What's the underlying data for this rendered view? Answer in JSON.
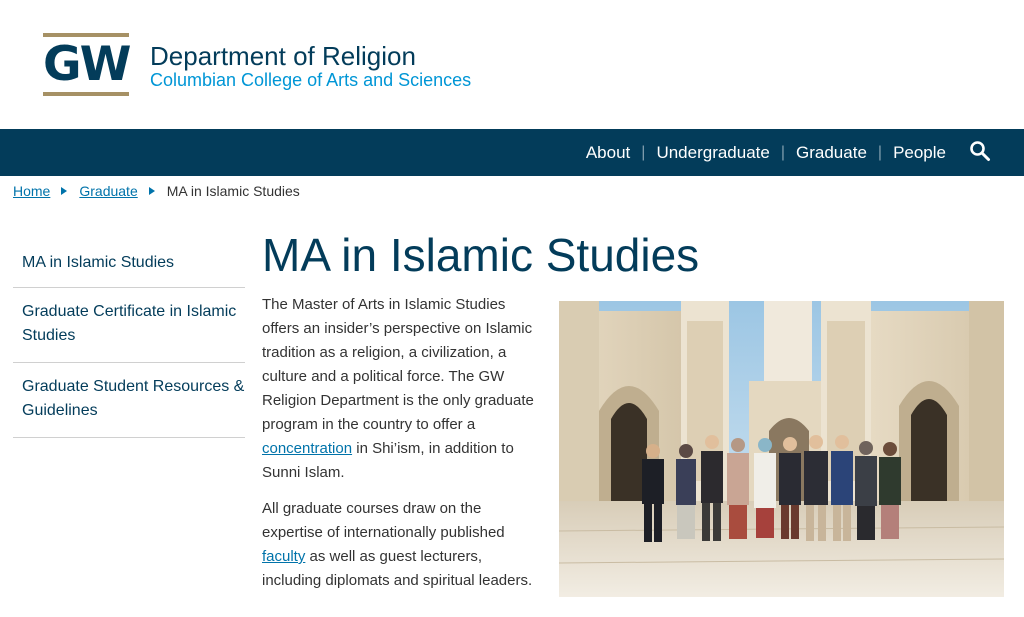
{
  "header": {
    "logo_text": "GW",
    "dept_name": "Department of Religion",
    "college_name": "Columbian College of Arts and Sciences"
  },
  "nav": {
    "items": [
      {
        "label": "About"
      },
      {
        "label": "Undergraduate"
      },
      {
        "label": "Graduate"
      },
      {
        "label": "People"
      }
    ],
    "separator": "|",
    "search_icon": "search-icon"
  },
  "breadcrumb": {
    "items": [
      {
        "label": "Home"
      },
      {
        "label": "Graduate"
      }
    ],
    "current": "MA in Islamic Studies"
  },
  "sidebar": {
    "items": [
      {
        "label": "MA in Islamic Studies"
      },
      {
        "label": "Graduate Certificate in Islamic Studies"
      },
      {
        "label": "Graduate Student Resources & Guidelines"
      }
    ]
  },
  "main": {
    "title": "MA in Islamic Studies",
    "para1_before_link": "The Master of Arts in Islamic Studies offers an insider’s perspective on Islamic tradition as a religion, a civilization, a culture and a political force. The GW Religion Department is the only graduate program in the country to offer a ",
    "para1_link": "concentration",
    "para1_after_link": " in Shi’ism, in addition to Sunni Islam.",
    "para2_before_link": "All graduate courses draw on the expertise of internationally published ",
    "para2_link": "faculty",
    "para2_after_link": " as well as guest lecturers, including diplomats and spiritual leaders."
  },
  "colors": {
    "navy": "#033c5a",
    "gold": "#a69165",
    "link_blue": "#0073aa",
    "college_blue": "#0096d6"
  }
}
